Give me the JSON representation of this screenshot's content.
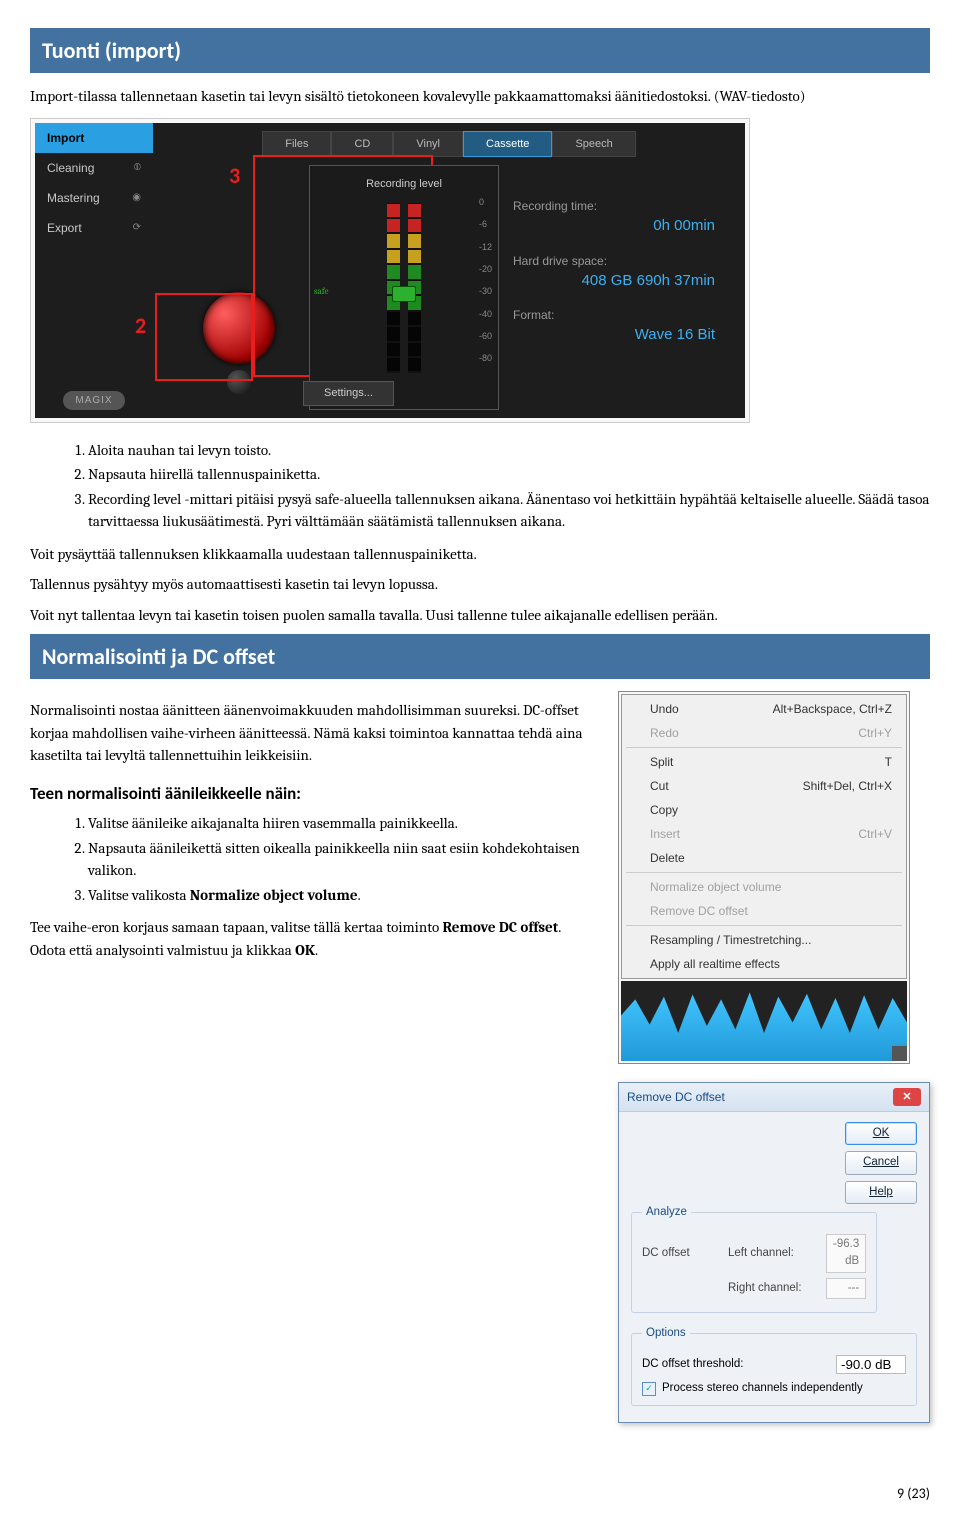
{
  "headers": {
    "tuonti": "Tuonti (import)",
    "normalisointi": "Normalisointi ja DC offset",
    "teen": "Teen normalisointi äänileikkeelle näin:"
  },
  "intro": "Import-tilassa tallennetaan kasetin tai levyn sisältö tietokoneen kovalevylle pakkaamattomaksi äänitiedostoksi. (WAV-tiedosto)",
  "app1": {
    "sidebar": {
      "import": "Import",
      "cleaning": "Cleaning",
      "mastering": "Mastering",
      "export": "Export"
    },
    "magix": "MAGIX",
    "tabs": {
      "files": "Files",
      "cd": "CD",
      "vinyl": "Vinyl",
      "cassette": "Cassette",
      "speech": "Speech"
    },
    "meter_label": "Recording level",
    "scale": [
      "0",
      "-6",
      "-12",
      "-20",
      "-30",
      "-40",
      "-60",
      "-80"
    ],
    "safe_text": "safe",
    "settings": "Settings...",
    "info": {
      "rec_time_label": "Recording time:",
      "rec_time_value": "0h 00min",
      "space_label": "Hard drive space:",
      "space_value": "408 GB   690h 37min",
      "format_label": "Format:",
      "format_value": "Wave 16 Bit"
    },
    "annot2": "2",
    "annot3": "3"
  },
  "list1": {
    "i1": "Aloita nauhan tai levyn toisto.",
    "i2": "Napsauta hiirellä tallennuspainiketta.",
    "i3": "Recording level -mittari pitäisi pysyä safe-alueella tallennuksen aikana. Äänentaso voi hetkittäin hypähtää keltaiselle alueelle. Säädä tasoa tarvittaessa liukusäätimestä. Pyri välttämään säätämistä tallennuksen aikana."
  },
  "paras": {
    "p1": "Voit pysäyttää tallennuksen klikkaamalla uudestaan tallennuspainiketta.",
    "p2": "Tallennus pysähtyy myös automaattisesti kasetin tai levyn lopussa.",
    "p3": "Voit nyt tallentaa levyn tai kasetin toisen puolen samalla tavalla. Uusi tallenne tulee aikajanalle edellisen perään.",
    "norm": "Normalisointi nostaa äänitteen äänenvoimakkuuden mahdollisimman suureksi. DC-offset korjaa mahdollisen vaihe-virheen äänitteessä. Nämä kaksi toimintoa kannattaa tehdä aina kasetilta tai levyltä tallennettuihin leikkeisiin.",
    "tee_p1a": "Tee vaihe-eron korjaus samaan tapaan, valitse tällä kertaa toiminto ",
    "tee_p1b": "Remove DC offset",
    "tee_p1c": ". Odota että analysointi valmistuu ja klikkaa ",
    "tee_p1d": "OK",
    "tee_p1e": "."
  },
  "list2": {
    "i1": "Valitse äänileike aikajanalta hiiren vasemmalla painikkeella.",
    "i2": "Napsauta äänileikettä sitten oikealla painikkeella niin saat esiin kohdekohtaisen valikon.",
    "i3a": "Valitse valikosta ",
    "i3b": "Normalize object volume",
    "i3c": "."
  },
  "ctxmenu": {
    "undo": "Undo",
    "undo_sc": "Alt+Backspace, Ctrl+Z",
    "redo": "Redo",
    "redo_sc": "Ctrl+Y",
    "split": "Split",
    "split_sc": "T",
    "cut": "Cut",
    "cut_sc": "Shift+Del, Ctrl+X",
    "copy": "Copy",
    "insert": "Insert",
    "insert_sc": "Ctrl+V",
    "delete": "Delete",
    "normalize": "Normalize object volume",
    "removedc": "Remove DC offset",
    "resample": "Resampling / Timestretching...",
    "applyfx": "Apply all realtime effects"
  },
  "dc": {
    "title": "Remove DC offset",
    "analyze": "Analyze",
    "dc_offset": "DC offset",
    "left": "Left channel:",
    "left_val": "-96.3 dB",
    "right": "Right channel:",
    "right_val": "---",
    "options": "Options",
    "thresh": "DC offset threshold:",
    "thresh_val": "-90.0 dB",
    "proc": "Process stereo channels independently",
    "ok": "OK",
    "cancel": "Cancel",
    "help": "Help"
  },
  "page_num": "9 (23)"
}
